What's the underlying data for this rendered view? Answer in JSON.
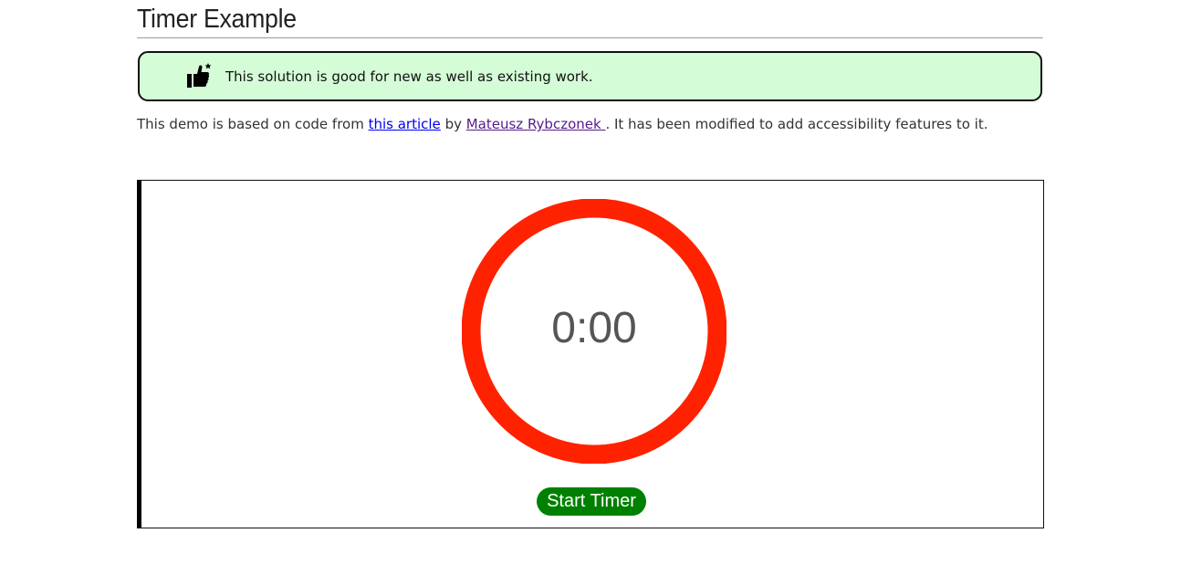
{
  "page": {
    "title": "Timer Example"
  },
  "notice": {
    "icon": "thumbs-up-star-icon",
    "text": "This solution is good for new as well as existing work.",
    "background": "#d4fcd6"
  },
  "intro": {
    "prefix": "This demo is based on code from ",
    "article_link": "this article",
    "middle": " by ",
    "author_link": "Mateusz Rybczonek ",
    "suffix": ". It has been modified to add accessibility features to it."
  },
  "timer": {
    "display": "0:00",
    "ring_color": "#ff2200",
    "start_button_label": "Start Timer",
    "button_color": "#008000"
  }
}
